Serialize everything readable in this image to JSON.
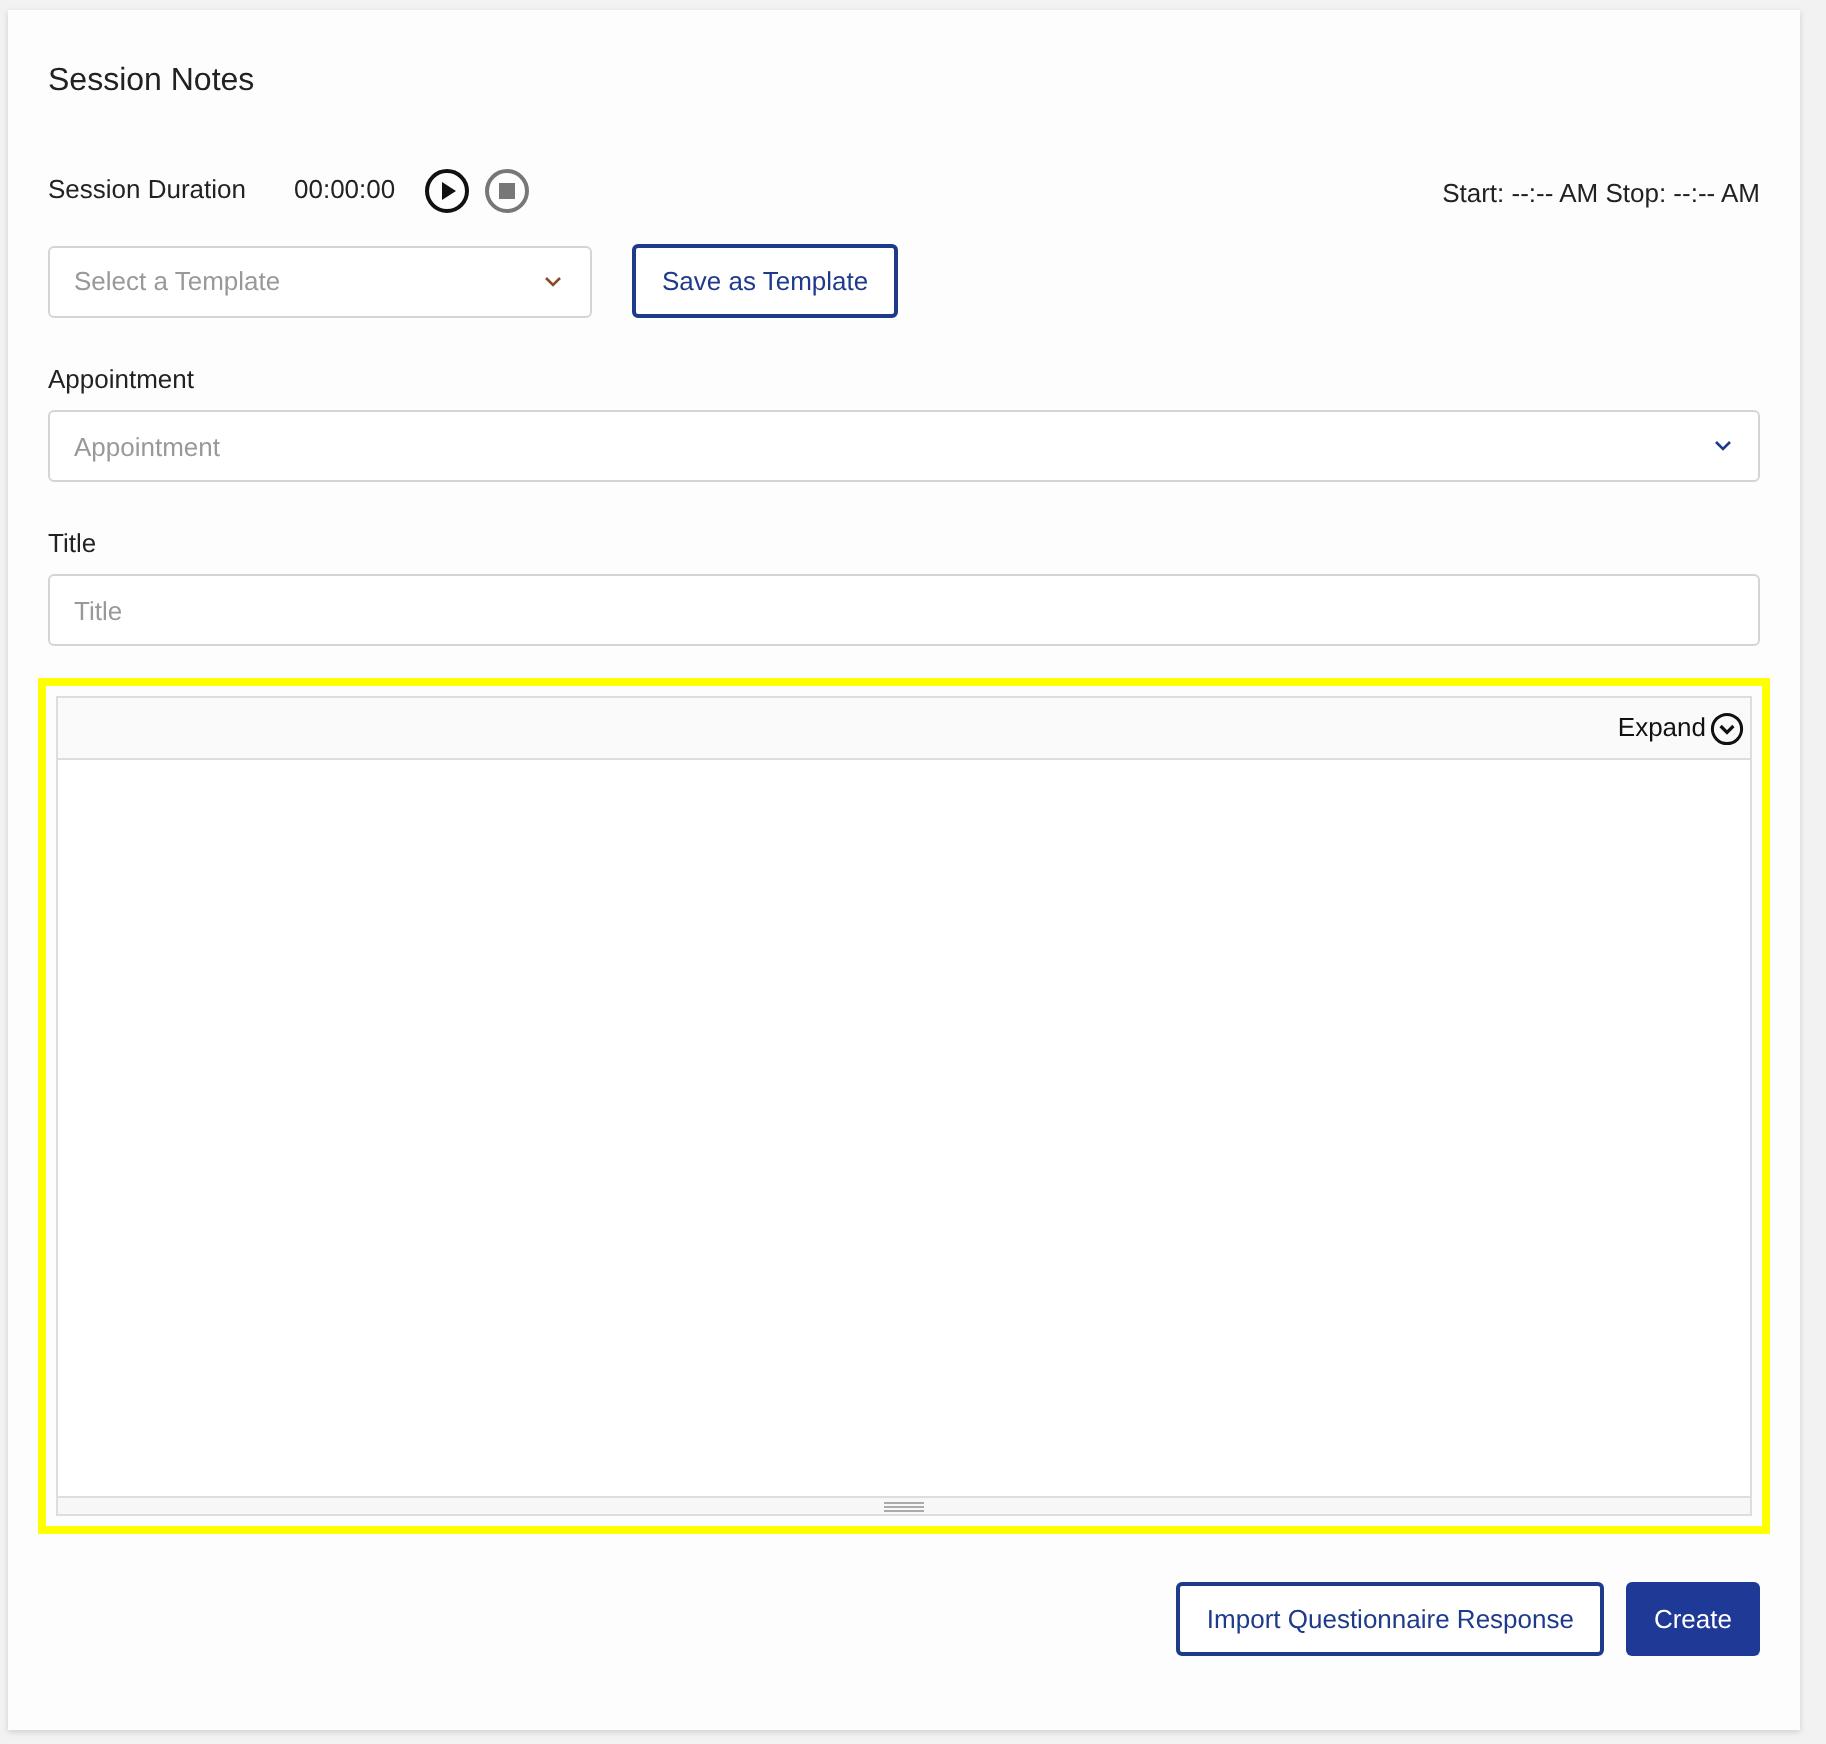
{
  "title": "Session Notes",
  "session": {
    "label": "Session Duration",
    "timer": "00:00:00",
    "times": "Start: --:-- AM Stop: --:-- AM"
  },
  "template_select": {
    "placeholder": "Select a Template"
  },
  "save_template_button": "Save as Template",
  "fields": [
    {
      "kind": "select",
      "label": "Appointment",
      "placeholder": "Appointment"
    },
    {
      "kind": "input",
      "label": "Title",
      "placeholder": "Title"
    }
  ],
  "editor": {
    "highlighted": true,
    "expand_label": "Expand"
  },
  "buttons": [
    {
      "kind": "outline",
      "label": "Import Questionnaire Response"
    },
    {
      "kind": "primary",
      "label": "Create"
    }
  ]
}
